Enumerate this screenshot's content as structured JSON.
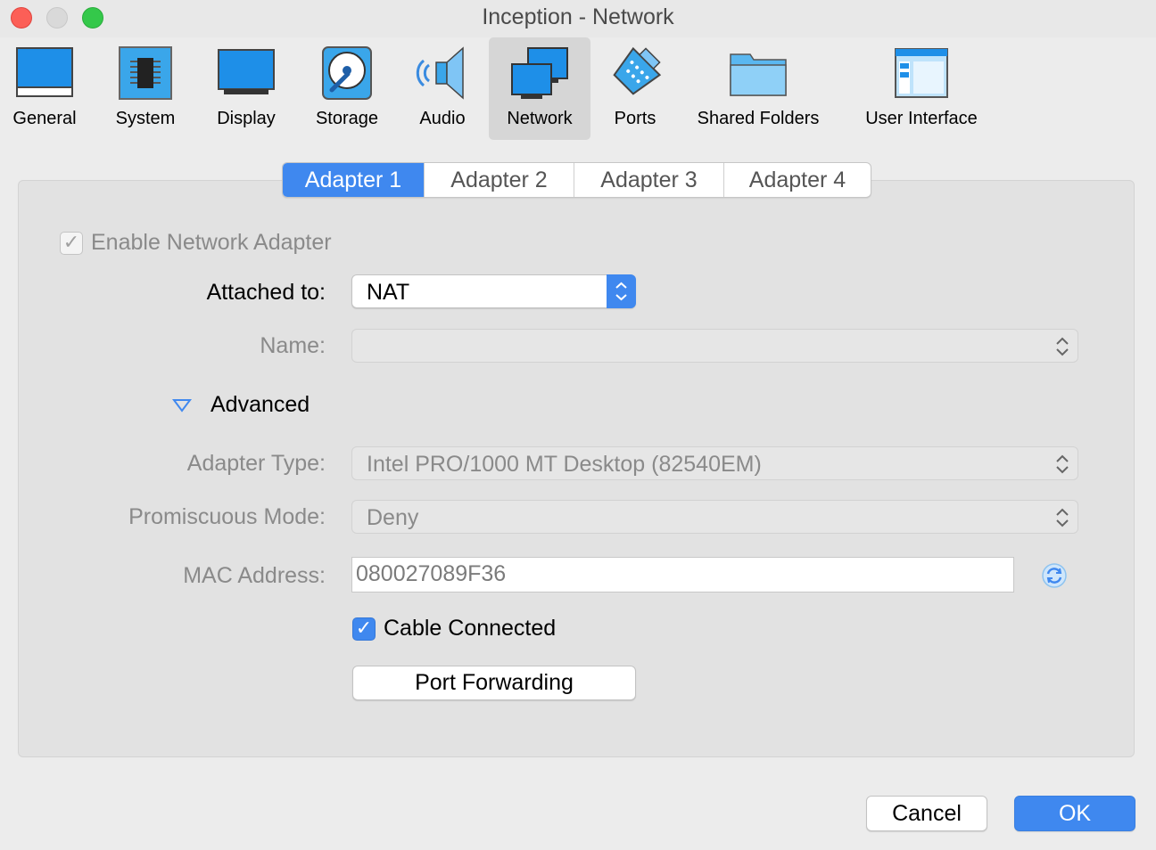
{
  "window": {
    "title": "Inception - Network"
  },
  "toolbar": {
    "items": [
      {
        "label": "General",
        "icon": "general-icon"
      },
      {
        "label": "System",
        "icon": "chip-icon"
      },
      {
        "label": "Display",
        "icon": "monitor-icon"
      },
      {
        "label": "Storage",
        "icon": "hard-disk-icon"
      },
      {
        "label": "Audio",
        "icon": "speaker-icon"
      },
      {
        "label": "Network",
        "icon": "network-icon",
        "selected": true
      },
      {
        "label": "Ports",
        "icon": "serial-port-icon"
      },
      {
        "label": "Shared Folders",
        "icon": "folder-icon"
      },
      {
        "label": "User Interface",
        "icon": "window-layout-icon"
      }
    ]
  },
  "tabs": [
    "Adapter 1",
    "Adapter 2",
    "Adapter 3",
    "Adapter 4"
  ],
  "active_tab": "Adapter 1",
  "form": {
    "enable_label": "Enable Network Adapter",
    "attached_label": "Attached to:",
    "attached_value": "NAT",
    "name_label": "Name:",
    "name_value": "",
    "advanced_label": "Advanced",
    "adapter_type_label": "Adapter Type:",
    "adapter_type_value": "Intel PRO/1000 MT Desktop (82540EM)",
    "promisc_label": "Promiscuous Mode:",
    "promisc_value": "Deny",
    "mac_label": "MAC Address:",
    "mac_value": "080027089F36",
    "cable_label": "Cable Connected",
    "port_forwarding_label": "Port Forwarding"
  },
  "buttons": {
    "cancel": "Cancel",
    "ok": "OK"
  },
  "colors": {
    "accent": "#3f88ef",
    "background": "#ececec"
  }
}
